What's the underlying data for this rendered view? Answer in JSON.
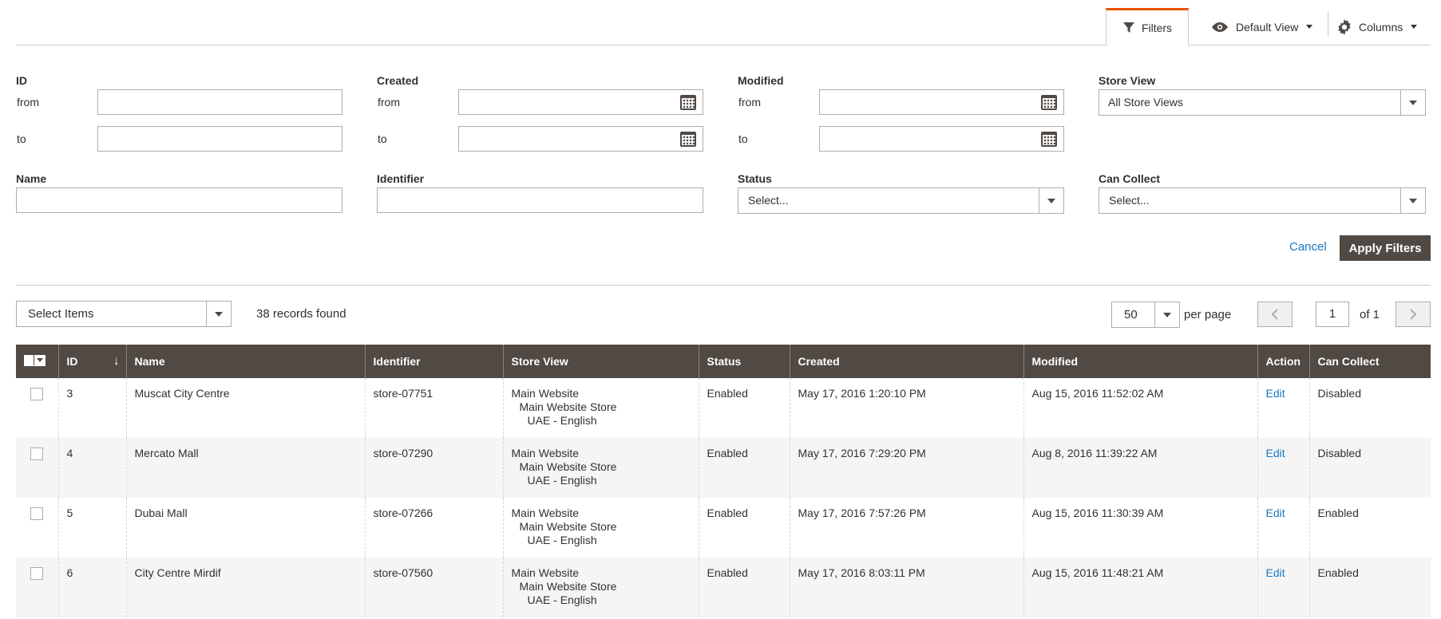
{
  "toolbar": {
    "filters_label": "Filters",
    "view_label": "Default View",
    "columns_label": "Columns"
  },
  "filters": {
    "id": {
      "title": "ID",
      "from_label": "from",
      "to_label": "to",
      "from_value": "",
      "to_value": ""
    },
    "created": {
      "title": "Created",
      "from_label": "from",
      "to_label": "to",
      "from_value": "",
      "to_value": ""
    },
    "modified": {
      "title": "Modified",
      "from_label": "from",
      "to_label": "to",
      "from_value": "",
      "to_value": ""
    },
    "store_view": {
      "title": "Store View",
      "value": "All Store Views"
    },
    "name": {
      "title": "Name",
      "value": ""
    },
    "identifier": {
      "title": "Identifier",
      "value": ""
    },
    "status": {
      "title": "Status",
      "value": "Select..."
    },
    "can_collect": {
      "title": "Can Collect",
      "value": "Select..."
    },
    "cancel_label": "Cancel",
    "apply_label": "Apply Filters"
  },
  "grid_controls": {
    "mass_action": "Select Items",
    "records_found": "38 records found",
    "per_page_value": "50",
    "per_page_label": "per page",
    "page_current": "1",
    "page_of": "of 1"
  },
  "table": {
    "headers": [
      "ID",
      "Name",
      "Identifier",
      "Store View",
      "Status",
      "Created",
      "Modified",
      "Action",
      "Can Collect"
    ],
    "sort_indicator": "↓",
    "rows": [
      {
        "id": "3",
        "name": "Muscat City Centre",
        "identifier": "store-07751",
        "sv1": "Main Website",
        "sv2": "Main Website Store",
        "sv3": "UAE - English",
        "status": "Enabled",
        "created": "May 17, 2016 1:20:10 PM",
        "modified": "Aug 15, 2016 11:52:02 AM",
        "action": "Edit",
        "can_collect": "Disabled"
      },
      {
        "id": "4",
        "name": "Mercato Mall",
        "identifier": "store-07290",
        "sv1": "Main Website",
        "sv2": "Main Website Store",
        "sv3": "UAE - English",
        "status": "Enabled",
        "created": "May 17, 2016 7:29:20 PM",
        "modified": "Aug 8, 2016 11:39:22 AM",
        "action": "Edit",
        "can_collect": "Disabled"
      },
      {
        "id": "5",
        "name": "Dubai Mall",
        "identifier": "store-07266",
        "sv1": "Main Website",
        "sv2": "Main Website Store",
        "sv3": "UAE - English",
        "status": "Enabled",
        "created": "May 17, 2016 7:57:26 PM",
        "modified": "Aug 15, 2016 11:30:39 AM",
        "action": "Edit",
        "can_collect": "Enabled"
      },
      {
        "id": "6",
        "name": "City Centre Mirdif",
        "identifier": "store-07560",
        "sv1": "Main Website",
        "sv2": "Main Website Store",
        "sv3": "UAE - English",
        "status": "Enabled",
        "created": "May 17, 2016 8:03:11 PM",
        "modified": "Aug 15, 2016 11:48:21 AM",
        "action": "Edit",
        "can_collect": "Enabled"
      }
    ]
  },
  "icons": {
    "filter": "filter-icon",
    "view": "eye-icon",
    "columns": "gear-icon",
    "calendar": "calendar-icon"
  },
  "colors": {
    "accent": "#eb5202",
    "header_bg": "#514943",
    "link": "#1979c3",
    "row_alt": "#f5f5f5"
  }
}
